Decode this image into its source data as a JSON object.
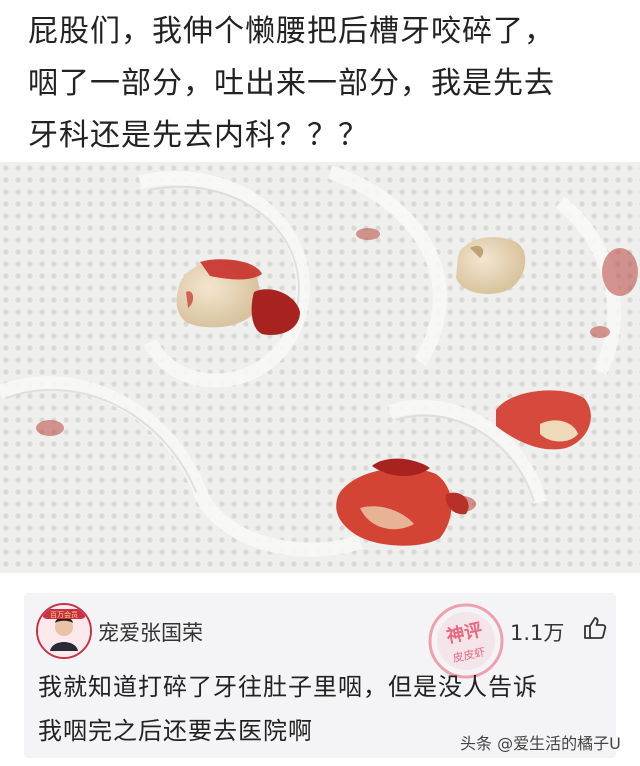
{
  "post": {
    "text_line1": "屁股们，我伸个懒腰把后槽牙咬碎了，",
    "text_line2": "咽了一部分，吐出来一部分，我是先去",
    "text_line3": "牙科还是先去内科？？？"
  },
  "comment": {
    "username": "宠爱张国荣",
    "like_count": "1.1万",
    "text_line1": "我就知道打碎了牙往肚子里咽，但是没人告诉",
    "text_line2": "我咽完之后还要去医院啊",
    "stamp_text_top": "神评",
    "stamp_text_bottom": "皮皮虾",
    "avatar_badge_text": "百万会员"
  },
  "watermark": "头条 @爱生活的橘子U",
  "colors": {
    "stamp": "#e8506a",
    "card_bg": "#f4f4f6",
    "tissue": "#eeeeec",
    "blood": "#c8302a"
  },
  "icons": {
    "like": "thumbs-up-icon"
  }
}
